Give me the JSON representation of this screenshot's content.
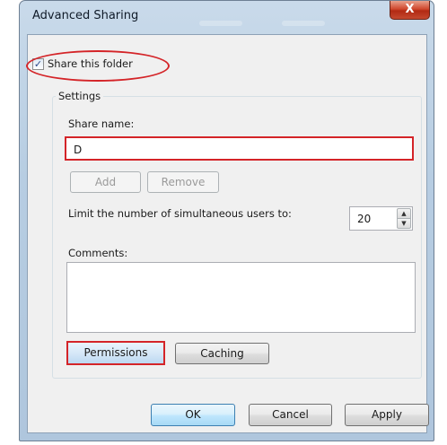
{
  "window": {
    "title": "Advanced Sharing",
    "close_glyph": "X"
  },
  "share_folder": {
    "label": "Share this folder",
    "checked": true,
    "check_glyph": "✓"
  },
  "settings": {
    "group_label": "Settings",
    "share_name_label": "Share name:",
    "share_name_value": "D",
    "add_label": "Add",
    "remove_label": "Remove",
    "limit_label": "Limit the number of simultaneous users to:",
    "limit_value": "20",
    "spin_up_glyph": "▲",
    "spin_down_glyph": "▼",
    "comments_label": "Comments:",
    "comments_value": "",
    "permissions_label": "Permissions",
    "caching_label": "Caching"
  },
  "footer": {
    "ok_label": "OK",
    "cancel_label": "Cancel",
    "apply_label": "Apply"
  },
  "colors": {
    "highlight": "#d42428",
    "titlebar": "#c9daea",
    "dialog_bg": "#f0f0f0"
  }
}
